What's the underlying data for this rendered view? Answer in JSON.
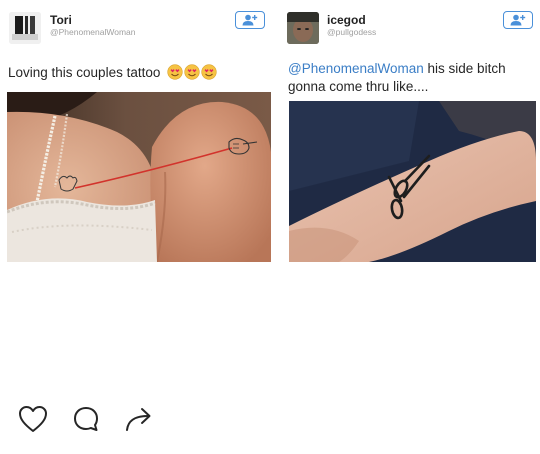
{
  "posts": [
    {
      "display_name": "Tori",
      "handle": "@PhenomenalWoman",
      "text": "Loving this couples tattoo",
      "emojis": [
        "smiling-face-with-heart-eyes-icon",
        "smiling-face-with-heart-eyes-icon",
        "smiling-face-with-heart-eyes-icon"
      ],
      "photo": "couple-red-string-tattoo-photo"
    },
    {
      "display_name": "icegod",
      "handle": "@pullgodess",
      "mention": "@PhenomenalWoman",
      "text_line1": " his side bitch",
      "text_line2": "gonna come thru like....",
      "photo": "wrist-scissors-tattoo-photo"
    }
  ],
  "actions": [
    "heart-icon",
    "comment-icon",
    "share-icon"
  ],
  "colors": {
    "follow_blue": "#4a90d9",
    "mention_blue": "#3b7ec6",
    "handle_gray": "#a0a0a0"
  }
}
